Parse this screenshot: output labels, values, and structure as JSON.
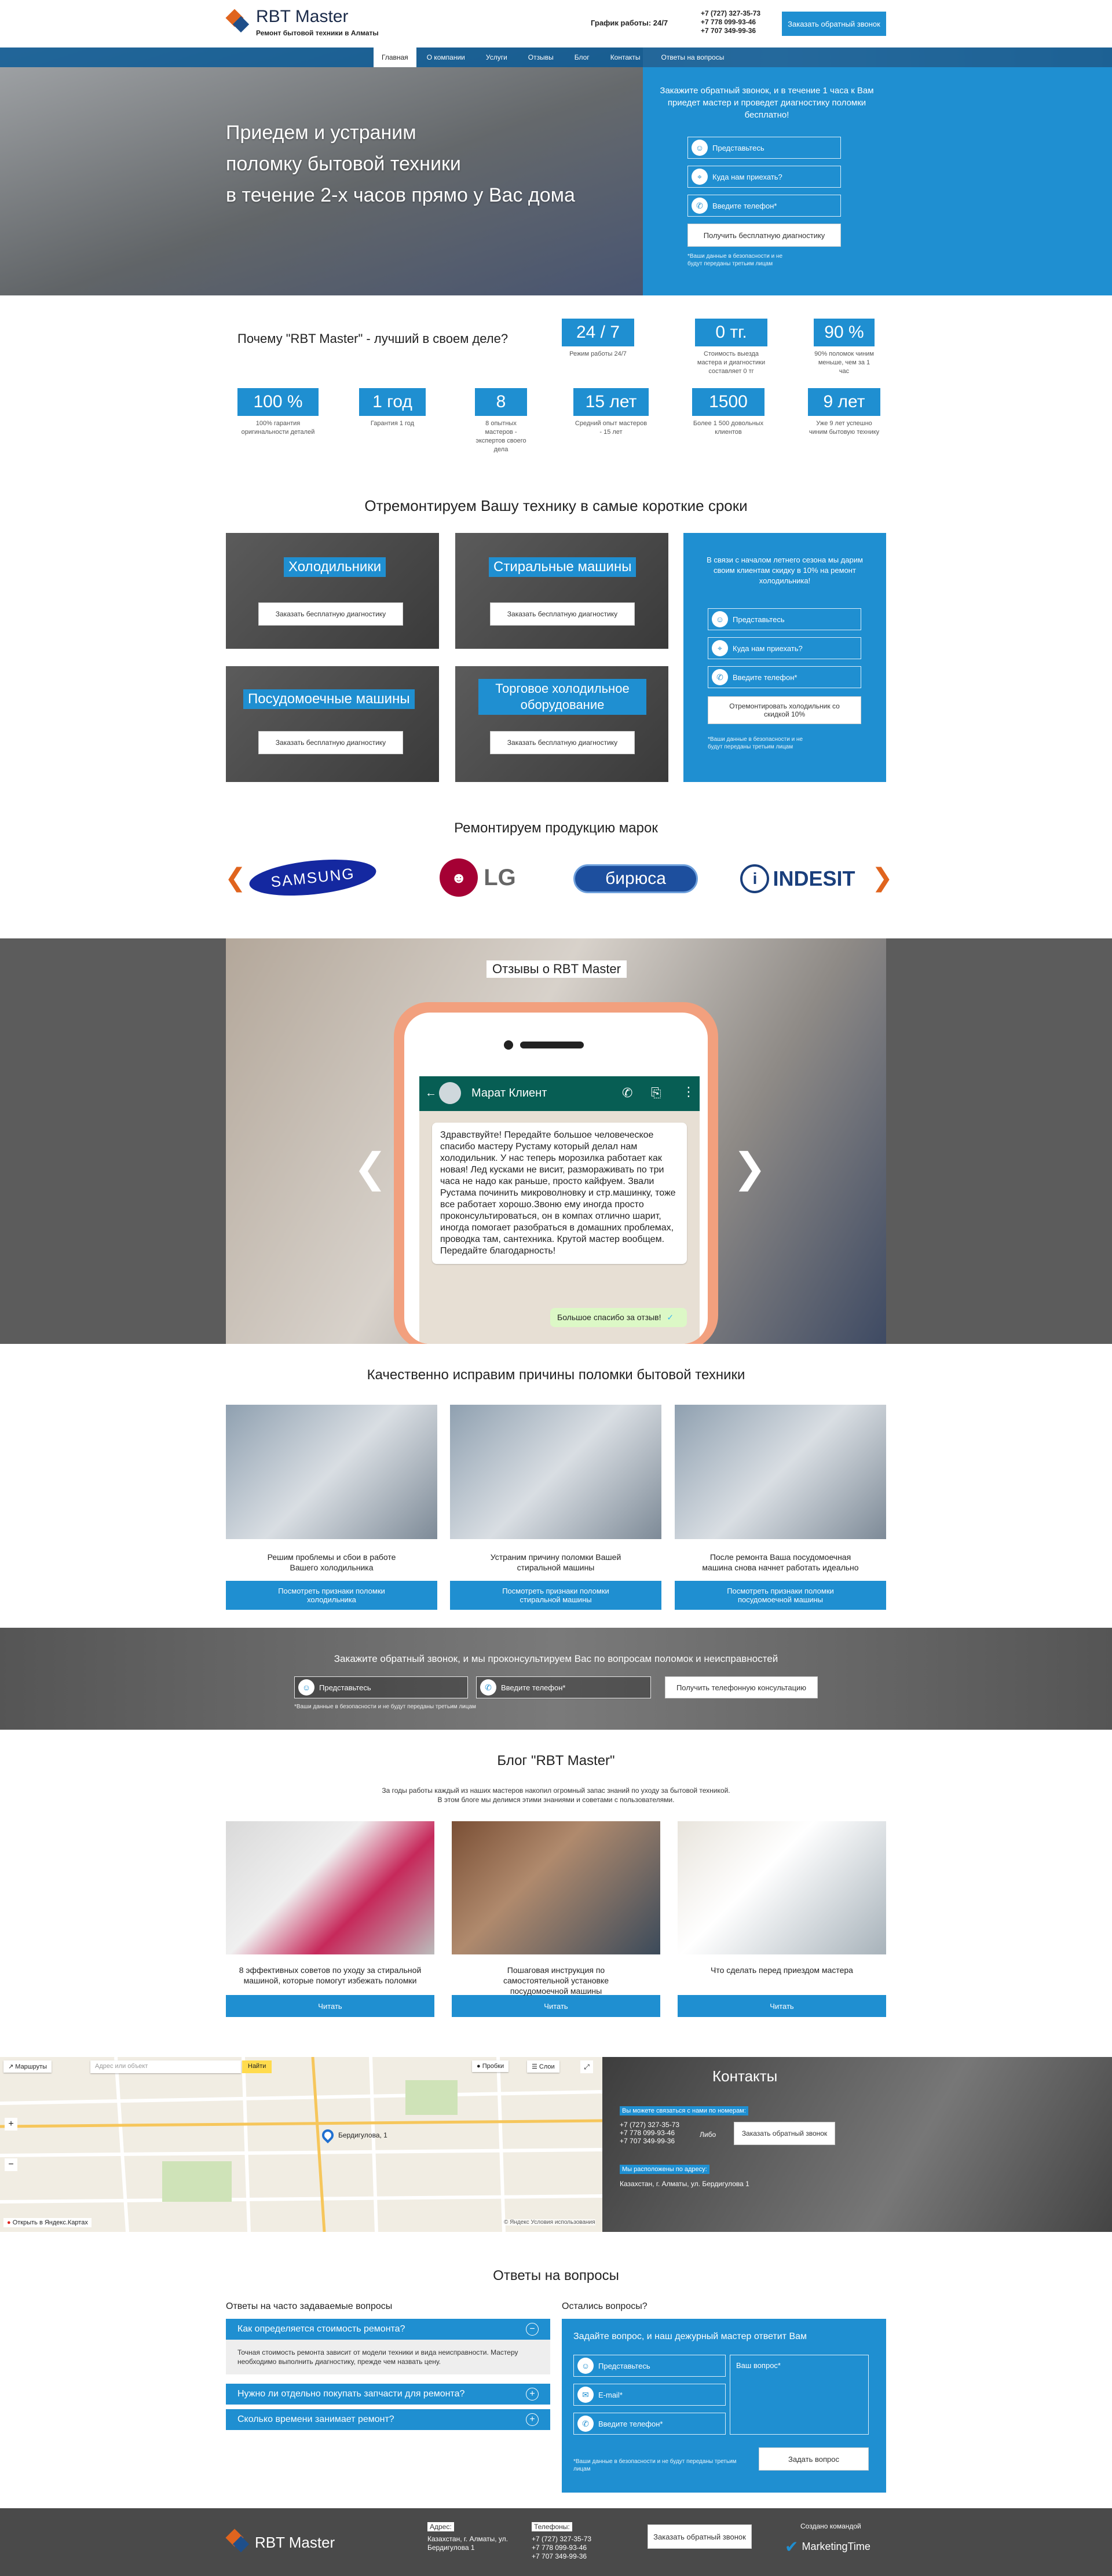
{
  "header": {
    "logo_title": "RBT Master",
    "logo_sub": "Ремонт бытовой техники в Алматы",
    "schedule": "График работы: 24/7",
    "phones": [
      "+7 (727) 327-35-73",
      "+7 778 099-93-46",
      "+7 707 349-99-36"
    ],
    "callback_button": "Заказать обратный звонок"
  },
  "nav": [
    "Главная",
    "О компании",
    "Услуги",
    "Отзывы",
    "Блог",
    "Контакты",
    "Ответы на вопросы"
  ],
  "hero": {
    "headline_1": "Приедем и устраним",
    "headline_2": "поломку бытовой техники",
    "headline_3": "в течение 2-х часов прямо у Вас дома",
    "form_text": "Закажите обратный звонок, и в течение 1 часа к Вам приедет мастер и проведет диагностику поломки бесплатно!",
    "name_placeholder": "Представьтесь",
    "address_placeholder": "Куда нам приехать?",
    "phone_placeholder": "Введите телефон*",
    "submit": "Получить бесплатную диагностику",
    "note": "*Ваши данные в безопасности и не будут переданы третьим лицам"
  },
  "why": {
    "title": "Почему \"RBT Master\" - лучший в своем деле?",
    "stats_top": [
      {
        "num": "24 / 7",
        "cap": "Режим работы 24/7"
      },
      {
        "num": "0 тг.",
        "cap": "Стоимость выезда мастера и диагностики составляет 0 тг"
      },
      {
        "num": "90 %",
        "cap": "90% поломок чиним меньше, чем за 1 час"
      }
    ],
    "stats_bottom": [
      {
        "num": "100 %",
        "cap": "100% гарантия оригинальности деталей"
      },
      {
        "num": "1 год",
        "cap": "Гарантия 1 год"
      },
      {
        "num": "8",
        "cap": "8 опытных мастеров - экспертов своего дела"
      },
      {
        "num": "15 лет",
        "cap": "Средний опыт мастеров - 15 лет"
      },
      {
        "num": "1500",
        "cap": "Более 1 500 довольных клиентов"
      },
      {
        "num": "9 лет",
        "cap": "Уже 9 лет успешно чиним бытовую технику"
      }
    ]
  },
  "repair": {
    "title": "Отремонтируем Вашу технику в самые короткие сроки",
    "cards": [
      {
        "title": "Холодильники",
        "button": "Заказать бесплатную диагностику"
      },
      {
        "title": "Стиральные машины",
        "button": "Заказать бесплатную диагностику"
      },
      {
        "title": "Посудомоечные машины",
        "button": "Заказать бесплатную диагностику"
      },
      {
        "title": "Торговое холодильное оборудование",
        "button": "Заказать бесплатную диагностику"
      }
    ],
    "promo_text": "В связи с началом летнего сезона мы дарим своим клиентам скидку в 10% на ремонт холодильника!",
    "promo_name": "Представьтесь",
    "promo_address": "Куда нам приехать?",
    "promo_phone": "Введите телефон*",
    "promo_button": "Отремонтировать холодильник со скидкой 10%",
    "promo_note": "*Ваши данные в безопасности и не будут переданы третьим лицам"
  },
  "brands": {
    "title": "Ремонтируем продукцию марок",
    "items": [
      "SAMSUNG",
      "LG",
      "бирюса",
      "INDESIT"
    ],
    "colors": {
      "samsung": "#1428a0",
      "lg": "#a50034",
      "biryusa": "#1d4f9e",
      "indesit": "#1a3f7c"
    }
  },
  "reviews": {
    "title": "Отзывы о RBT Master",
    "chat_name": "Марат Клиент",
    "message": "Здравствуйте! Передайте большое человеческое спасибо мастеру Рустаму который делал нам холодильник. У нас теперь морозилка работает как новая! Лед кусками не висит, размораживать по три часа не надо как раньше, просто кайфуем. Звали Рустама починить микроволновку и стр.машинку, тоже все работает хорошо.Звоню ему иногда просто проконсультироваться, он в компах отлично шарит, иногда помогает разобраться в домашних проблемах, проводка там, сантехника. Крутой мастер вообщем. Передайте благодарность!",
    "reply": "Большое спасибо за отзыв!"
  },
  "quality": {
    "title": "Качественно исправим причины поломки бытовой техники",
    "items": [
      {
        "text": "Решим проблемы и сбои в работе Вашего холодильника",
        "button": "Посмотреть признаки поломки холодильника"
      },
      {
        "text": "Устраним причину поломки Вашей стиральной машины",
        "button": "Посмотреть признаки поломки стиральной машины"
      },
      {
        "text": "После ремонта Ваша посудомоечная машина снова начнет работать идеально",
        "button": "Посмотреть признаки поломки посудомоечной машины"
      }
    ]
  },
  "consult": {
    "text": "Закажите обратный звонок, и мы проконсультируем Вас по вопросам поломок и неисправностей",
    "name_placeholder": "Представьтесь",
    "phone_placeholder": "Введите телефон*",
    "button": "Получить телефонную консультацию",
    "note": "*Ваши данные в безопасности и не будут переданы третьим лицам"
  },
  "blog": {
    "title": "Блог \"RBT Master\"",
    "intro_1": "За годы работы каждый из наших мастеров накопил огромный запас знаний по уходу за бытовой техникой.",
    "intro_2": "В этом блоге мы делимся этими знаниями и советами с пользователями.",
    "posts": [
      {
        "text": "8 эффективных советов по уходу за стиральной машиной, которые помогут избежать поломки",
        "button": "Читать"
      },
      {
        "text": "Пошаговая инструкция по самостоятельной установке посудомоечной машины",
        "button": "Читать"
      },
      {
        "text": "Что сделать перед приездом мастера",
        "button": "Читать"
      }
    ]
  },
  "map": {
    "routes": "Маршруты",
    "search_placeholder": "Адрес или объект",
    "find": "Найти",
    "traffic": "Пробки",
    "layers": "Слои",
    "marker": "Бердигулова, 1",
    "open_link": "Открыть в Яндекс.Картах",
    "copyright": "© Яндекс  Условия использования"
  },
  "contacts": {
    "title": "Контакты",
    "call_label": "Вы можете связаться с нами по номерам:",
    "phones": [
      "+7 (727) 327-35-73",
      "+7 778 099-93-46",
      "+7 707 349-99-36"
    ],
    "or": "Либо",
    "callback_button": "Заказать обратный звонок",
    "addr_label": "Мы расположены по адресу:",
    "address": "Казахстан, г. Алматы, ул. Бердигулова 1"
  },
  "faq": {
    "title": "Ответы на вопросы",
    "left_title": "Ответы на часто задаваемые вопросы",
    "q1": "Как определяется стоимость ремонта?",
    "a1": "Точная стоимость ремонта зависит от модели техники и вида неисправности. Мастеру необходимо выполнить диагностику, прежде чем назвать цену.",
    "q2": "Нужно ли отдельно покупать запчасти для ремонта?",
    "q3": "Сколько времени занимает ремонт?",
    "right_title": "Остались вопросы?",
    "form_title": "Задайте вопрос, и наш дежурный мастер ответит Вам",
    "name_placeholder": "Представьтесь",
    "email_placeholder": "E-mail*",
    "phone_placeholder": "Введите телефон*",
    "question_placeholder": "Ваш вопрос*",
    "submit": "Задать вопрос",
    "note": "*Ваши данные в безопасности и не будут переданы третьим лицам"
  },
  "footer": {
    "logo_title": "RBT Master",
    "addr_label": "Адрес:",
    "address": "Казахстан, г. Алматы, ул. Бердигулова 1",
    "phones_label": "Телефоны:",
    "phones": [
      "+7 (727) 327-35-73",
      "+7 778 099-93-46",
      "+7 707 349-99-36"
    ],
    "callback_button": "Заказать обратный звонок",
    "made_by": "Создано командой",
    "agency": "MarketingTime"
  }
}
